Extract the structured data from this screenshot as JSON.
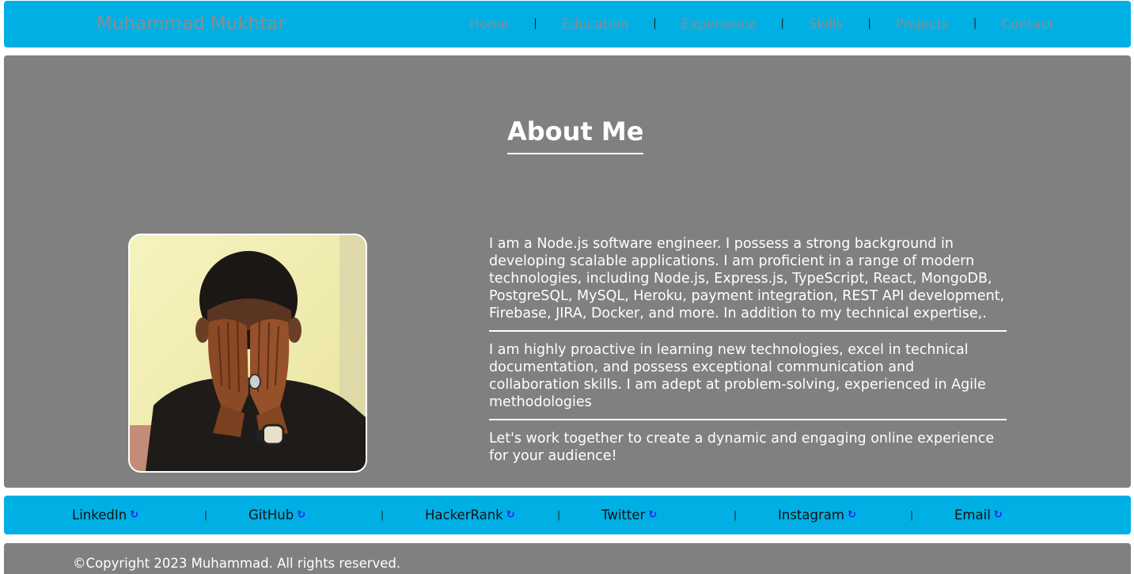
{
  "header": {
    "brand": "Muhammad Mukhtar",
    "nav": [
      {
        "label": "Home"
      },
      {
        "label": "Education"
      },
      {
        "label": "Experience"
      },
      {
        "label": "Skills"
      },
      {
        "label": "Projects"
      },
      {
        "label": "Contact"
      }
    ],
    "separator": "|"
  },
  "about": {
    "title": "About Me",
    "photo_icon": "profile-photo",
    "paragraphs": [
      "I am a Node.js software engineer. I possess a strong background in developing scalable applications. I am proficient in a range of modern technologies, including Node.js, Express.js, TypeScript, React, MongoDB, PostgreSQL, MySQL, Heroku, payment integration, REST API development, Firebase, JIRA, Docker, and more. In addition to my technical expertise,.",
      "I am highly proactive in learning new technologies, excel in technical documentation, and possess exceptional communication and collaboration skills. I am adept at problem-solving, experienced in Agile methodologies",
      "Let's work together to create a dynamic and engaging online experience for your audience!"
    ]
  },
  "social": {
    "links": [
      {
        "label": "LinkedIn"
      },
      {
        "label": "GitHub"
      },
      {
        "label": "HackerRank"
      },
      {
        "label": "Twitter"
      },
      {
        "label": "Instagram"
      },
      {
        "label": "Email"
      }
    ],
    "link_icon": "↻",
    "separator": "|"
  },
  "footer": {
    "copyright": "©Copyright 2023 Muhammad. All rights reserved."
  },
  "colors": {
    "bar_blue": "#00b0e5",
    "panel_gray": "#808080",
    "muted_text": "#8c8c8c"
  }
}
